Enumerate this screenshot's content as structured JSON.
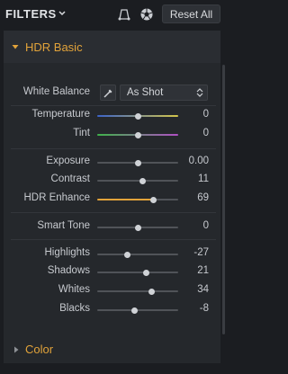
{
  "topbar": {
    "title": "FILTERS",
    "reset_label": "Reset All",
    "icons": [
      "chevron-down-icon",
      "crop-icon",
      "aperture-icon"
    ]
  },
  "hdr_basic": {
    "title": "HDR Basic",
    "white_balance": {
      "label": "White Balance",
      "value": "As Shot"
    },
    "sliders": [
      {
        "label": "Temperature",
        "value": "0",
        "level": 0.5,
        "track": "temperature"
      },
      {
        "label": "Tint",
        "value": "0",
        "level": 0.5,
        "track": "tint"
      },
      {
        "label": "Exposure",
        "value": "0.00",
        "level": 0.5,
        "track": "plain"
      },
      {
        "label": "Contrast",
        "value": "11",
        "level": 0.555,
        "track": "plain"
      },
      {
        "label": "HDR Enhance",
        "value": "69",
        "level": 0.69,
        "track": "enhance"
      },
      {
        "label": "Smart Tone",
        "value": "0",
        "level": 0.5,
        "track": "plain"
      },
      {
        "label": "Highlights",
        "value": "-27",
        "level": 0.365,
        "track": "plain"
      },
      {
        "label": "Shadows",
        "value": "21",
        "level": 0.605,
        "track": "plain"
      },
      {
        "label": "Whites",
        "value": "34",
        "level": 0.67,
        "track": "plain"
      },
      {
        "label": "Blacks",
        "value": "-8",
        "level": 0.46,
        "track": "plain"
      }
    ]
  },
  "color_section": {
    "title": "Color"
  },
  "colors": {
    "accent": "#e2a33a",
    "temperature_left": "#3b63c9",
    "temperature_right": "#d4c64a",
    "tint_left": "#3fb24a",
    "tint_right": "#b04fc4"
  }
}
